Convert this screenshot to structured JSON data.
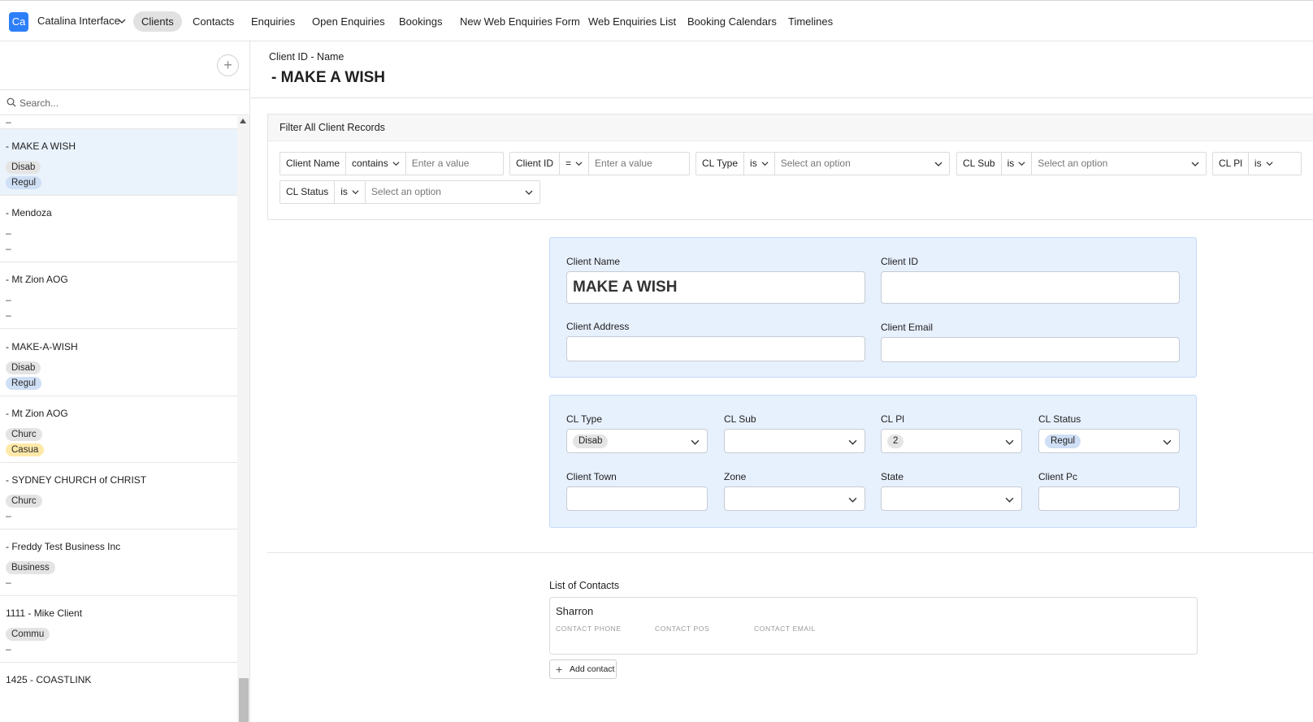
{
  "app": {
    "logo_text": "Ca",
    "name": "Catalina Interface"
  },
  "nav": {
    "tabs": [
      {
        "label": "Clients",
        "active": true
      },
      {
        "label": "Contacts"
      },
      {
        "label": "Enquiries"
      },
      {
        "label": "Open Enquiries"
      },
      {
        "label": "Bookings"
      },
      {
        "label": "New Web Enquiries Form"
      },
      {
        "label": "Web Enquiries List"
      },
      {
        "label": "Booking Calendars"
      },
      {
        "label": "Timelines"
      }
    ]
  },
  "sidebar": {
    "add_button": "+",
    "search_placeholder": "Search...",
    "top_partial_line": "–",
    "records": [
      {
        "title": "- MAKE A WISH",
        "chip1": "Disab",
        "chip2": "Regul",
        "selected": true
      },
      {
        "title": "- Mendoza",
        "line1": "–",
        "line2": "–"
      },
      {
        "title": "- Mt Zion AOG",
        "line1": "–",
        "line2": "–"
      },
      {
        "title": "- MAKE-A-WISH",
        "chip1": "Disab",
        "chip2": "Regul"
      },
      {
        "title": "- Mt Zion AOG",
        "chip1": "Churc",
        "chip2": "Casua"
      },
      {
        "title": "- SYDNEY CHURCH of CHRIST",
        "chip1": "Churc",
        "line2": "–"
      },
      {
        "title": "- Freddy Test Business Inc",
        "chip1": "Business",
        "line2": "–"
      },
      {
        "title": "1111 - Mike Client",
        "chip1": "Commu",
        "line2": "–"
      },
      {
        "title": "1425 - COASTLINK"
      }
    ]
  },
  "record": {
    "breadcrumb": "Client ID - Name",
    "name": "- MAKE A WISH"
  },
  "filters": {
    "title": "Filter All Client Records",
    "client_name": {
      "field": "Client Name",
      "op": "contains",
      "placeholder": "Enter a value"
    },
    "client_id": {
      "field": "Client ID",
      "op": "=",
      "placeholder": "Enter a value"
    },
    "cl_type": {
      "field": "CL Type",
      "op": "is",
      "placeholder": "Select an option"
    },
    "cl_sub": {
      "field": "CL Sub",
      "op": "is",
      "placeholder": "Select an option"
    },
    "cl_pl": {
      "field": "CL Pl",
      "op": "is"
    },
    "cl_status": {
      "field": "CL Status",
      "op": "is",
      "placeholder": "Select an option"
    }
  },
  "form": {
    "client_name_label": "Client Name",
    "client_name_value": "MAKE A WISH",
    "client_id_label": "Client ID",
    "client_id_value": "",
    "client_address_label": "Client Address",
    "client_address_value": "",
    "client_email_label": "Client Email",
    "client_email_value": "",
    "cl_type_label": "CL Type",
    "cl_type_value": "Disab",
    "cl_sub_label": "CL Sub",
    "cl_pl_label": "CL Pl",
    "cl_pl_value": "2",
    "cl_status_label": "CL Status",
    "cl_status_value": "Regul",
    "client_town_label": "Client Town",
    "zone_label": "Zone",
    "state_label": "State",
    "client_pc_label": "Client Pc"
  },
  "contacts": {
    "label": "List of Contacts",
    "items": [
      {
        "name": "Sharron",
        "phone_label": "CONTACT PHONE",
        "pos_label": "CONTACT POS",
        "email_label": "CONTACT EMAIL"
      }
    ],
    "add_label": "Add contact"
  },
  "colors": {
    "accent": "#2d7ff9",
    "card_bg": "#e7f0fd",
    "chip_gray": "#e4e4e4",
    "chip_blue": "#cfdff5",
    "chip_yellow": "#ffe9a8",
    "selected_row": "#eaf2fc"
  },
  "icons": {
    "app_menu": "chevron-down-icon",
    "search": "search-icon",
    "add": "plus-icon",
    "select": "chevron-down-icon"
  }
}
